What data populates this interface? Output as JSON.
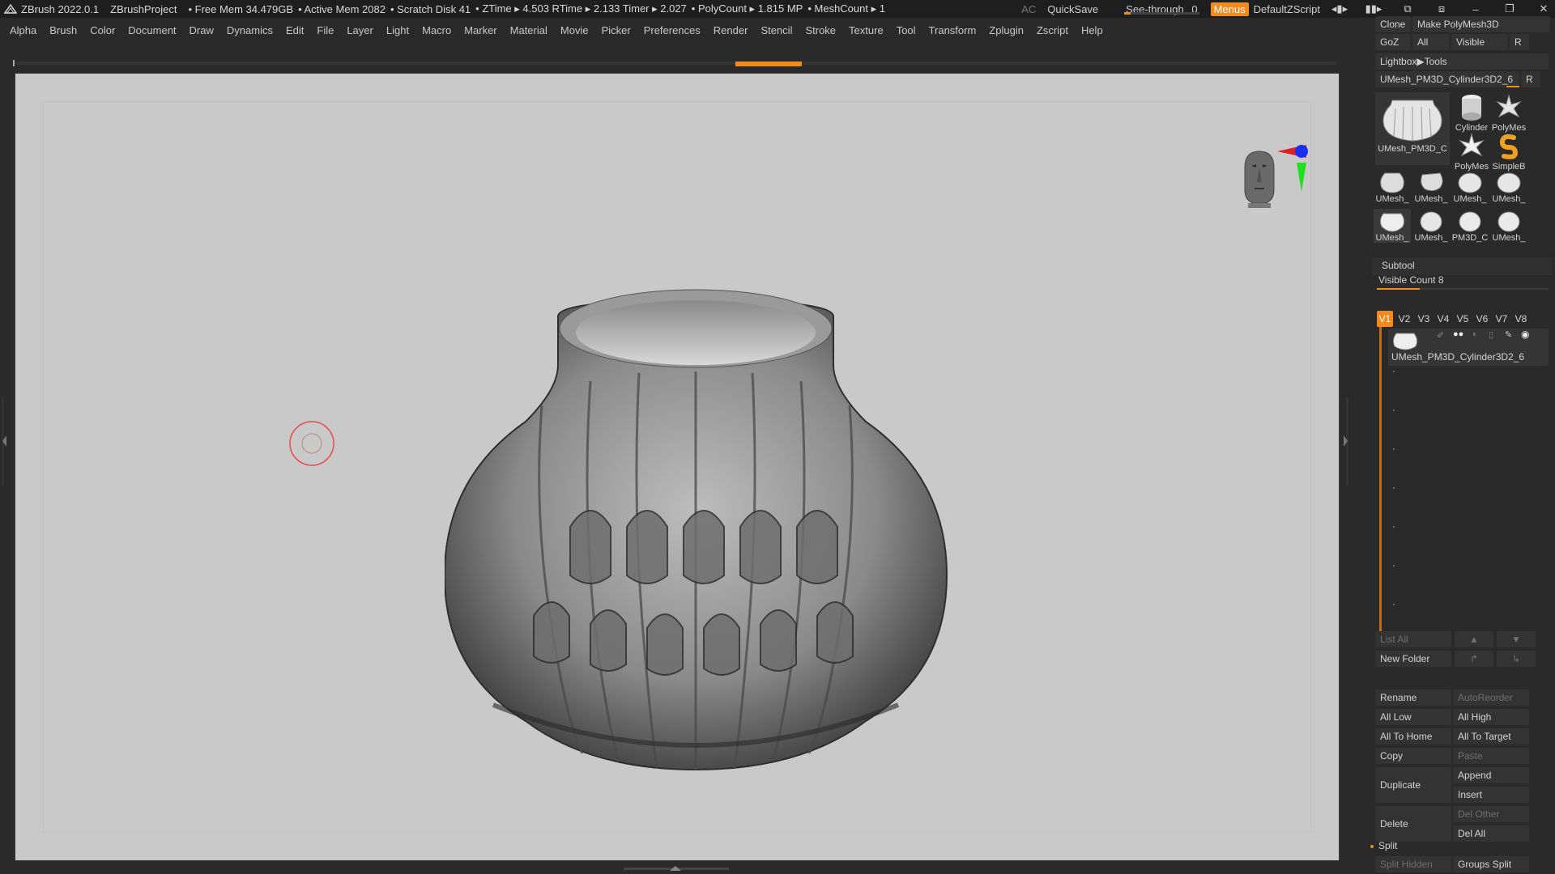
{
  "topbar": {
    "app_title": "ZBrush 2022.0.1",
    "project": "ZBrushProject",
    "free_mem": "• Free Mem 34.479GB",
    "active_mem": "• Active Mem 2082",
    "scratch_disk": "• Scratch Disk 41",
    "ztime": "• ZTime ▸ 4.503 RTime ▸ 2.133 Timer ▸ 2.027",
    "polycount": "• PolyCount ▸ 1.815 MP",
    "meshcount": "• MeshCount ▸ 1",
    "ac_label": "AC",
    "quicksave_label": "QuickSave",
    "seethrough_label": "See-through",
    "seethrough_value": "0",
    "seethrough_fraction": 0.0,
    "menus_label": "Menus",
    "default_zscript_label": "DefaultZScript"
  },
  "menubar": {
    "items": [
      "Alpha",
      "Brush",
      "Color",
      "Document",
      "Draw",
      "Dynamics",
      "Edit",
      "File",
      "Layer",
      "Light",
      "Macro",
      "Marker",
      "Material",
      "Movie",
      "Picker",
      "Preferences",
      "Render",
      "Stencil",
      "Stroke",
      "Texture",
      "Tool",
      "Transform",
      "Zplugin",
      "Zscript",
      "Help"
    ]
  },
  "colors": {
    "accent": "#f28a1c",
    "viewport_bg": "#c9c9c9",
    "panel_bg": "#2a2a2a",
    "button_bg": "#333333"
  },
  "tool_panel": {
    "clone_label": "Clone",
    "make_polymesh_label": "Make PolyMesh3D",
    "goz_label": "GoZ",
    "all_label": "All",
    "visible_label": "Visible",
    "r_label": "R",
    "lightbox_tools_label": "Lightbox▶Tools",
    "current_tool_name": "UMesh_PM3D_Cylinder3D2_6",
    "main_thumb_label": "UMesh_PM3D_C",
    "thumbs": [
      {
        "label": "Cylinder",
        "icon": "cylinder-icon"
      },
      {
        "label": "PolyMes",
        "icon": "star-icon"
      },
      {
        "label": "PolyMes",
        "icon": "star-icon"
      },
      {
        "label": "SimpleB",
        "icon": "simplebrush-icon"
      },
      {
        "label": "UMesh_",
        "icon": "vase-icon"
      },
      {
        "label": "UMesh_",
        "icon": "vase-icon"
      },
      {
        "label": "UMesh_",
        "icon": "vase-icon"
      },
      {
        "label": "UMesh_",
        "icon": "vase-icon"
      },
      {
        "label": "UMesh_",
        "icon": "vase-icon"
      },
      {
        "label": "UMesh_",
        "icon": "vase-icon"
      },
      {
        "label": "PM3D_C",
        "icon": "vase-icon"
      },
      {
        "label": "UMesh_",
        "icon": "vase-icon"
      }
    ]
  },
  "subtool": {
    "title": "Subtool",
    "visible_count": "Visible Count 8",
    "visible_count_fraction": 0.25,
    "tabs": [
      "V1",
      "V2",
      "V3",
      "V4",
      "V5",
      "V6",
      "V7",
      "V8"
    ],
    "active_tab": "V1",
    "item_name": "UMesh_PM3D_Cylinder3D2_6",
    "list_all": "List All",
    "new_folder": "New Folder",
    "rename": "Rename",
    "autoreorder": "AutoReorder",
    "all_low": "All Low",
    "all_high": "All High",
    "all_to_home": "All To Home",
    "all_to_target": "All To Target",
    "copy": "Copy",
    "paste": "Paste",
    "duplicate": "Duplicate",
    "append": "Append",
    "insert": "Insert",
    "delete": "Delete",
    "del_other": "Del Other",
    "del_all": "Del All",
    "split": "Split",
    "split_hidden": "Split Hidden",
    "groups_split": "Groups Split"
  }
}
